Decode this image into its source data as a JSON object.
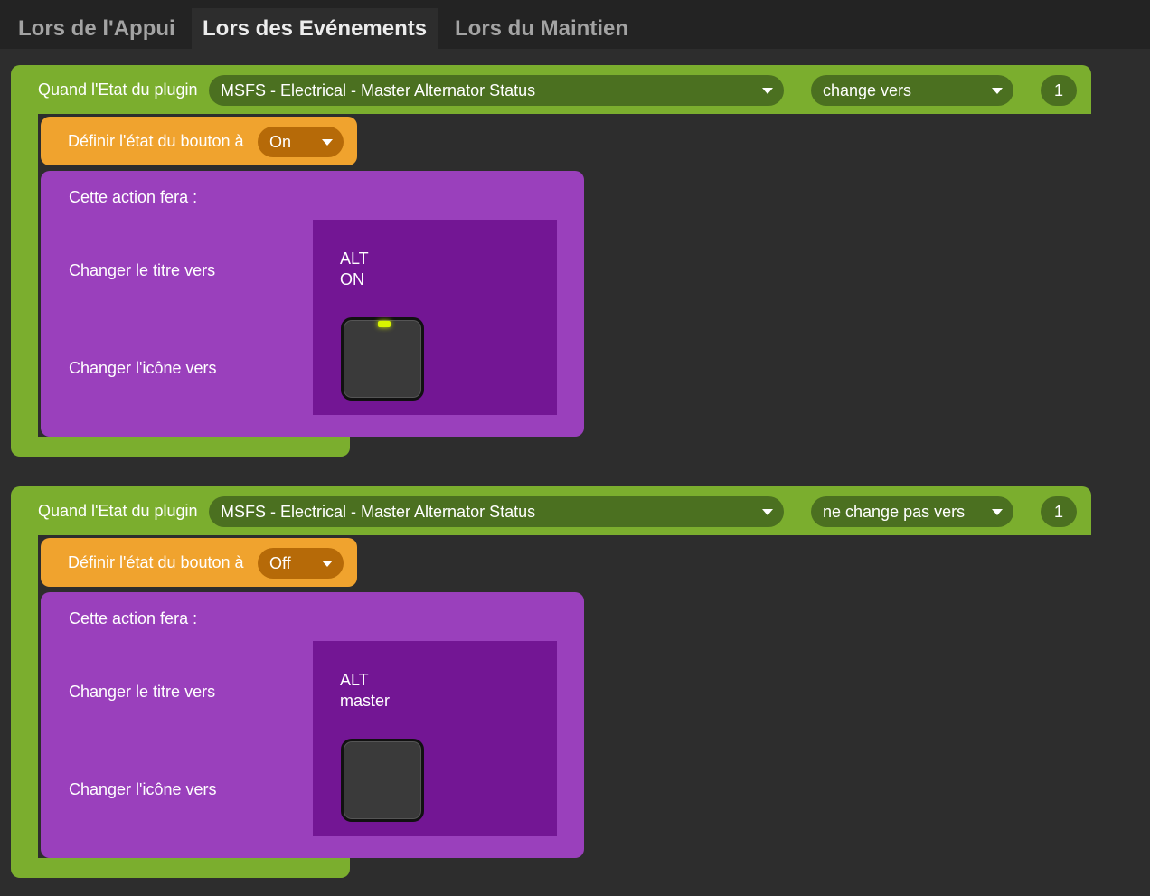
{
  "tabs": [
    {
      "label": "Lors de l'Appui",
      "active": false
    },
    {
      "label": "Lors des Evénements",
      "active": true
    },
    {
      "label": "Lors du Maintien",
      "active": false
    }
  ],
  "events": [
    {
      "when_label": "Quand l'Etat du plugin",
      "plugin_state": "MSFS - Electrical - Master Alternator Status",
      "condition": "change vers",
      "value": "1",
      "set_state_label": "Définir l'état du bouton à",
      "set_state_value": "On",
      "action_header": "Cette action fera :",
      "change_title_label": "Changer le titre vers",
      "change_icon_label": "Changer l'icône vers",
      "title_preview": "ALT\nON",
      "icon": "key-led-on-icon"
    },
    {
      "when_label": "Quand l'Etat du plugin",
      "plugin_state": "MSFS - Electrical - Master Alternator Status",
      "condition": "ne change pas vers",
      "value": "1",
      "set_state_label": "Définir l'état du bouton à",
      "set_state_value": "Off",
      "action_header": "Cette action fera :",
      "change_title_label": "Changer le titre vers",
      "change_icon_label": "Changer l'icône vers",
      "title_preview": "ALT\nmaster",
      "icon": "key-plain-icon"
    }
  ],
  "colors": {
    "background": "#2d2d2d",
    "event_green": "#7bae2e",
    "dropdown_green": "#4b7020",
    "state_orange": "#f0a32e",
    "action_purple": "#9a40bc",
    "preview_purple": "#731694",
    "led": "#d8f400"
  }
}
